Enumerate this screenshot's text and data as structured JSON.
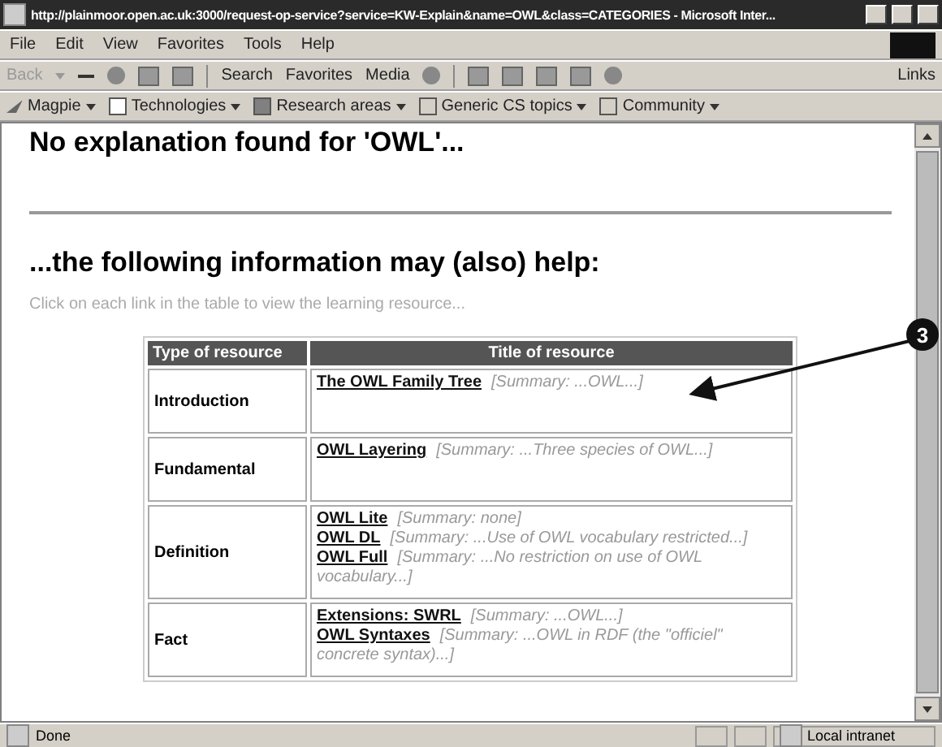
{
  "window": {
    "title": "http://plainmoor.open.ac.uk:3000/request-op-service?service=KW-Explain&name=OWL&class=CATEGORIES - Microsoft Inter..."
  },
  "menu": [
    "File",
    "Edit",
    "View",
    "Favorites",
    "Tools",
    "Help"
  ],
  "toolbar": [
    {
      "label": "Back",
      "disabled": true
    },
    {
      "label": "Search",
      "disabled": false
    },
    {
      "label": "Favorites",
      "disabled": false
    },
    {
      "label": "Media",
      "disabled": false
    }
  ],
  "links_label": "Links",
  "links_bar": [
    {
      "label": "Magpie",
      "kind": "logo"
    },
    {
      "label": "Technologies",
      "kind": "category",
      "color": "#ffffff"
    },
    {
      "label": "Research areas",
      "kind": "category",
      "color": "#808080"
    },
    {
      "label": "Generic CS topics",
      "kind": "category",
      "color": "#d4d0c8"
    },
    {
      "label": "Community",
      "kind": "category",
      "color": "#d4d0c8"
    }
  ],
  "page": {
    "heading": "No explanation found for 'OWL'...",
    "subheading": "...the following information may (also) help:",
    "hint": "Click on each link in the table to view the learning resource...",
    "table": {
      "columns": [
        "Type of resource",
        "Title of resource"
      ],
      "rows": [
        {
          "type": "Introduction",
          "resources": [
            {
              "title": "The OWL Family Tree",
              "summary": "[Summary: ...OWL...]"
            }
          ]
        },
        {
          "type": "Fundamental",
          "resources": [
            {
              "title": "OWL Layering",
              "summary": "[Summary: ...Three species of OWL...]"
            }
          ]
        },
        {
          "type": "Definition",
          "resources": [
            {
              "title": "OWL Lite",
              "summary": "[Summary: none]"
            },
            {
              "title": "OWL DL",
              "summary": "[Summary: ...Use of OWL vocabulary restricted...]"
            },
            {
              "title": "OWL Full",
              "summary": "[Summary: ...No restriction on use of OWL vocabulary...]"
            }
          ]
        },
        {
          "type": "Fact",
          "resources": [
            {
              "title": "Extensions: SWRL",
              "summary": "[Summary: ...OWL...]"
            },
            {
              "title": "OWL Syntaxes",
              "summary": "[Summary: ...OWL in RDF (the \"officiel\" concrete syntax)...]"
            }
          ]
        }
      ]
    }
  },
  "callout": {
    "number": "3"
  },
  "status_bar": {
    "left": "Done",
    "zone": "Local intranet"
  }
}
